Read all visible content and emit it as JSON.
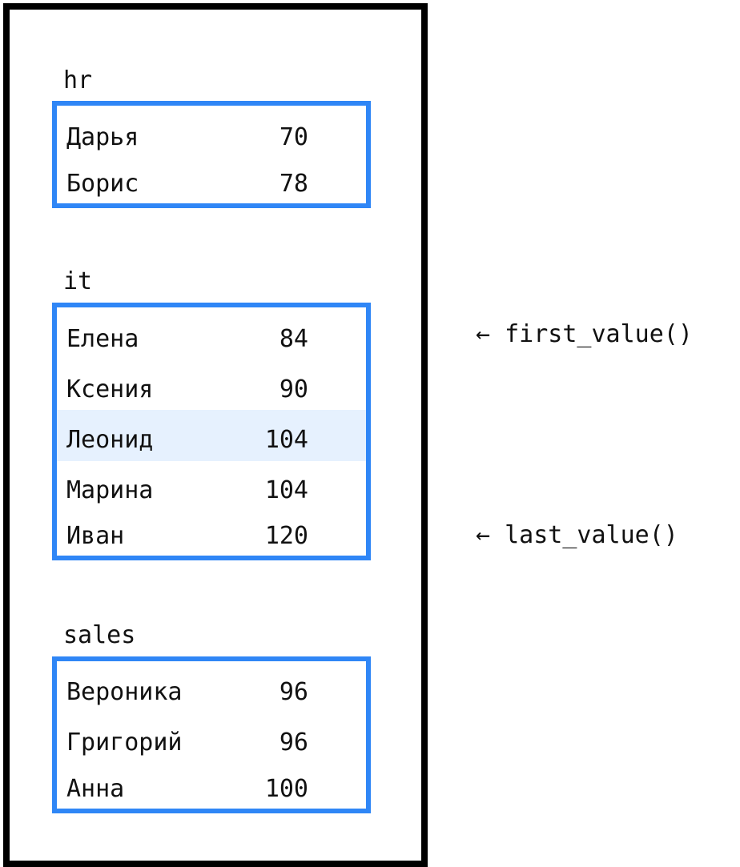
{
  "groups": [
    {
      "label": "hr",
      "rows": [
        {
          "name": "Дарья",
          "value": "70"
        },
        {
          "name": "Борис",
          "value": "78"
        }
      ]
    },
    {
      "label": "it",
      "rows": [
        {
          "name": "Елена",
          "value": "84"
        },
        {
          "name": "Ксения",
          "value": "90"
        },
        {
          "name": "Леонид",
          "value": "104",
          "highlighted": true
        },
        {
          "name": "Марина",
          "value": "104"
        },
        {
          "name": "Иван",
          "value": "120"
        }
      ]
    },
    {
      "label": "sales",
      "rows": [
        {
          "name": "Вероника",
          "value": "96"
        },
        {
          "name": "Григорий",
          "value": "96"
        },
        {
          "name": "Анна",
          "value": "100"
        }
      ]
    }
  ],
  "annotations": {
    "first": "← first_value()",
    "last": "← last_value()"
  },
  "colors": {
    "box_border": "#2f86f6",
    "highlight_row": "#e6f1fe",
    "frame": "#000000"
  }
}
